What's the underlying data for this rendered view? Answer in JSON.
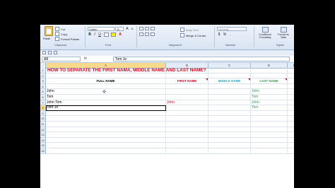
{
  "ribbon": {
    "clipboard": {
      "paste": "Paste",
      "cut": "Cut",
      "copy": "Copy",
      "format_painter": "Format Painter",
      "label": "Clipboard"
    },
    "font": {
      "name": "Calibri",
      "size": "11",
      "label": "Font"
    },
    "alignment": {
      "wrap_text": "Wrap Text",
      "merge_center": "Merge & Center",
      "label": "Alignment"
    },
    "number": {
      "format": "General",
      "label": "Number"
    },
    "styles": {
      "conditional": "Conditional Formatting",
      "format_table": "Format as Table",
      "label": "Styles"
    }
  },
  "formula_bar": {
    "name_box": "A8",
    "fx": "fx",
    "content": "Tom Jo"
  },
  "columns": [
    "A",
    "B",
    "C",
    "D",
    "E"
  ],
  "rows": [
    "1",
    "2",
    "3",
    "4",
    "5",
    "6",
    "7",
    "8",
    "9",
    "10",
    "11",
    "12",
    "13",
    "14",
    "15",
    "16"
  ],
  "sheet": {
    "title": "HOW TO SEPARATE THE FIRST NAMA, MIDDLE NAME AND LAST NAME?",
    "headers": {
      "full_name": "FULL NAME",
      "first_name": "FIRST NAME",
      "middle_name": "MIDDLE NAME",
      "last_name": "LAST NAME"
    },
    "a5": "John",
    "a6": "Tom",
    "a7": "John Tom",
    "a8": "Tom Jo",
    "b7": "John",
    "d5": "John",
    "d6": "Tom",
    "d7": "John",
    "d8": "Tom"
  },
  "colors": {
    "title_red": "#d4001b",
    "middle_teal": "#23a9c1",
    "last_green": "#2e9e4b",
    "header_bar": "#e4ecf7"
  }
}
